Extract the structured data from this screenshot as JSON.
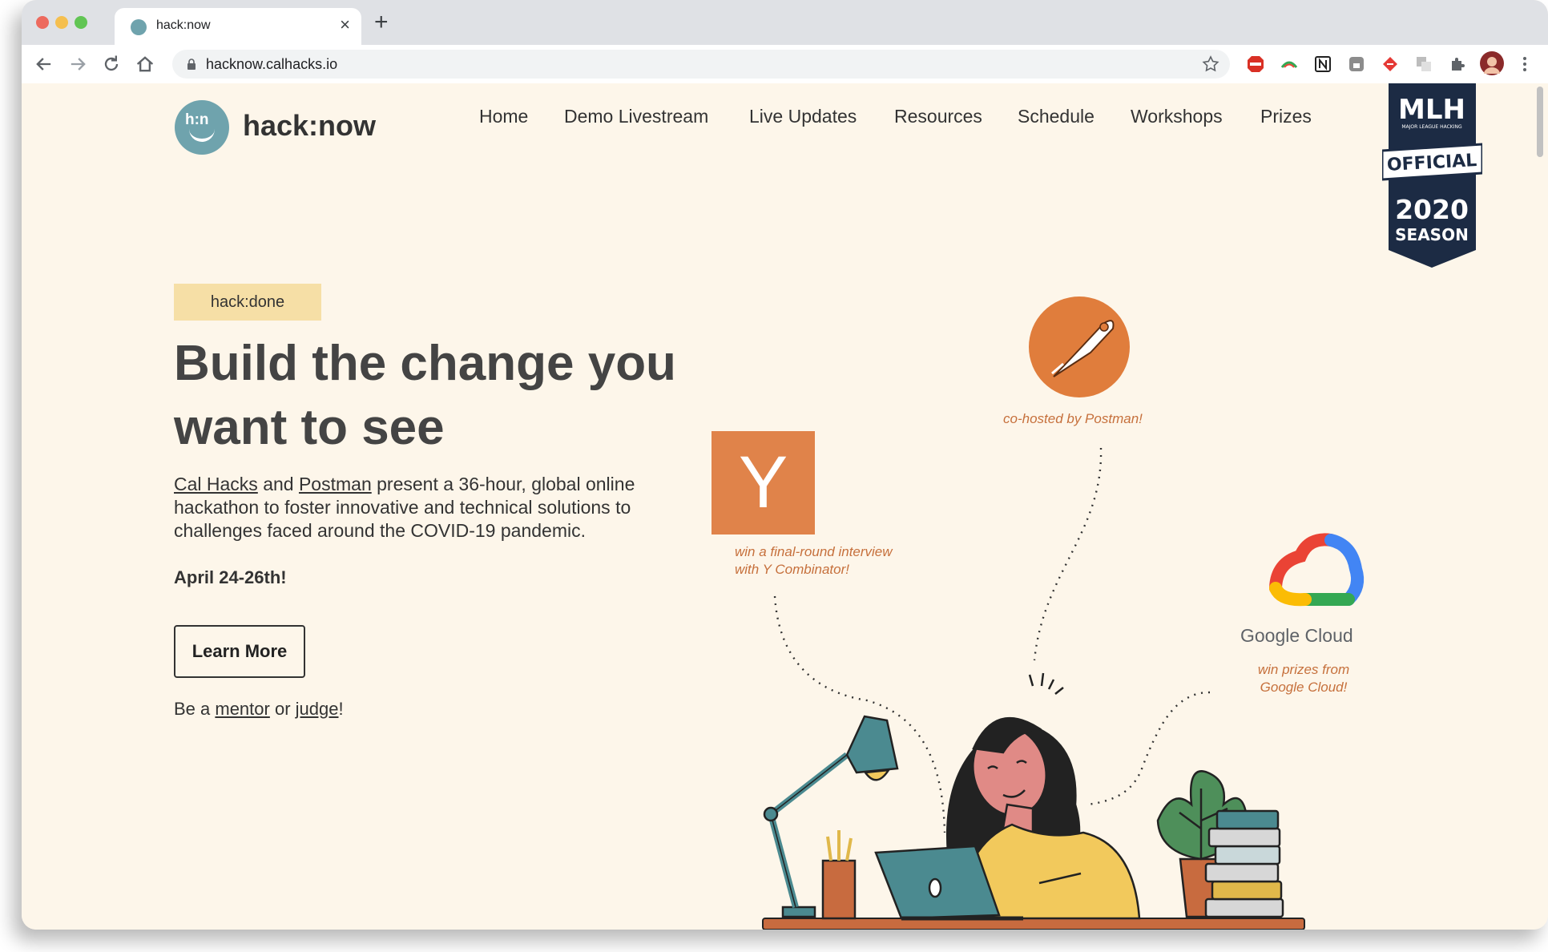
{
  "browser": {
    "tab_title": "hack:now",
    "tab_close": "×",
    "new_tab": "+",
    "url": "hacknow.calhacks.io",
    "colors": {
      "close": "#ed6a5e",
      "minimize": "#f5bf4f",
      "maximize": "#61c554"
    }
  },
  "site": {
    "logo_text": "h:n",
    "brand": "hack:now",
    "nav": [
      "Home",
      "Demo Livestream",
      "Live Updates",
      "Resources",
      "Schedule",
      "Workshops",
      "Prizes"
    ],
    "mlh": {
      "line1": "MLH",
      "line2": "MAJOR LEAGUE HACKING",
      "line3": "OFFICIAL",
      "line4": "2020",
      "line5": "SEASON"
    }
  },
  "hero": {
    "badge": "hack:done",
    "headline": "Build the change you want to see",
    "desc_link1": "Cal Hacks",
    "desc_and": " and ",
    "desc_link2": "Postman",
    "desc_rest": " present a 36-hour, global online hackathon to foster innovative and technical solutions to challenges faced around the COVID-19 pandemic.",
    "date": "April 24-26th!",
    "learn_more": "Learn More",
    "cta_prefix": "Be a ",
    "cta_mentor": "mentor",
    "cta_or": " or ",
    "cta_judge": "judge",
    "cta_suffix": "!"
  },
  "sponsors": {
    "postman_caption": "co-hosted by Postman!",
    "yc_letter": "Y",
    "yc_caption_1": "win a final-round interview",
    "yc_caption_2": "with Y Combinator!",
    "gc_name": "Google Cloud",
    "gc_caption_1": "win prizes from",
    "gc_caption_2": "Google Cloud!"
  },
  "colors": {
    "page_bg": "#fdf6ea",
    "accent_teal": "#6fa3ad",
    "postman_orange": "#e07d3c",
    "yc_orange": "#e0834a",
    "badge_yellow": "#f6dfa6",
    "mlh_navy": "#1c2b44"
  }
}
